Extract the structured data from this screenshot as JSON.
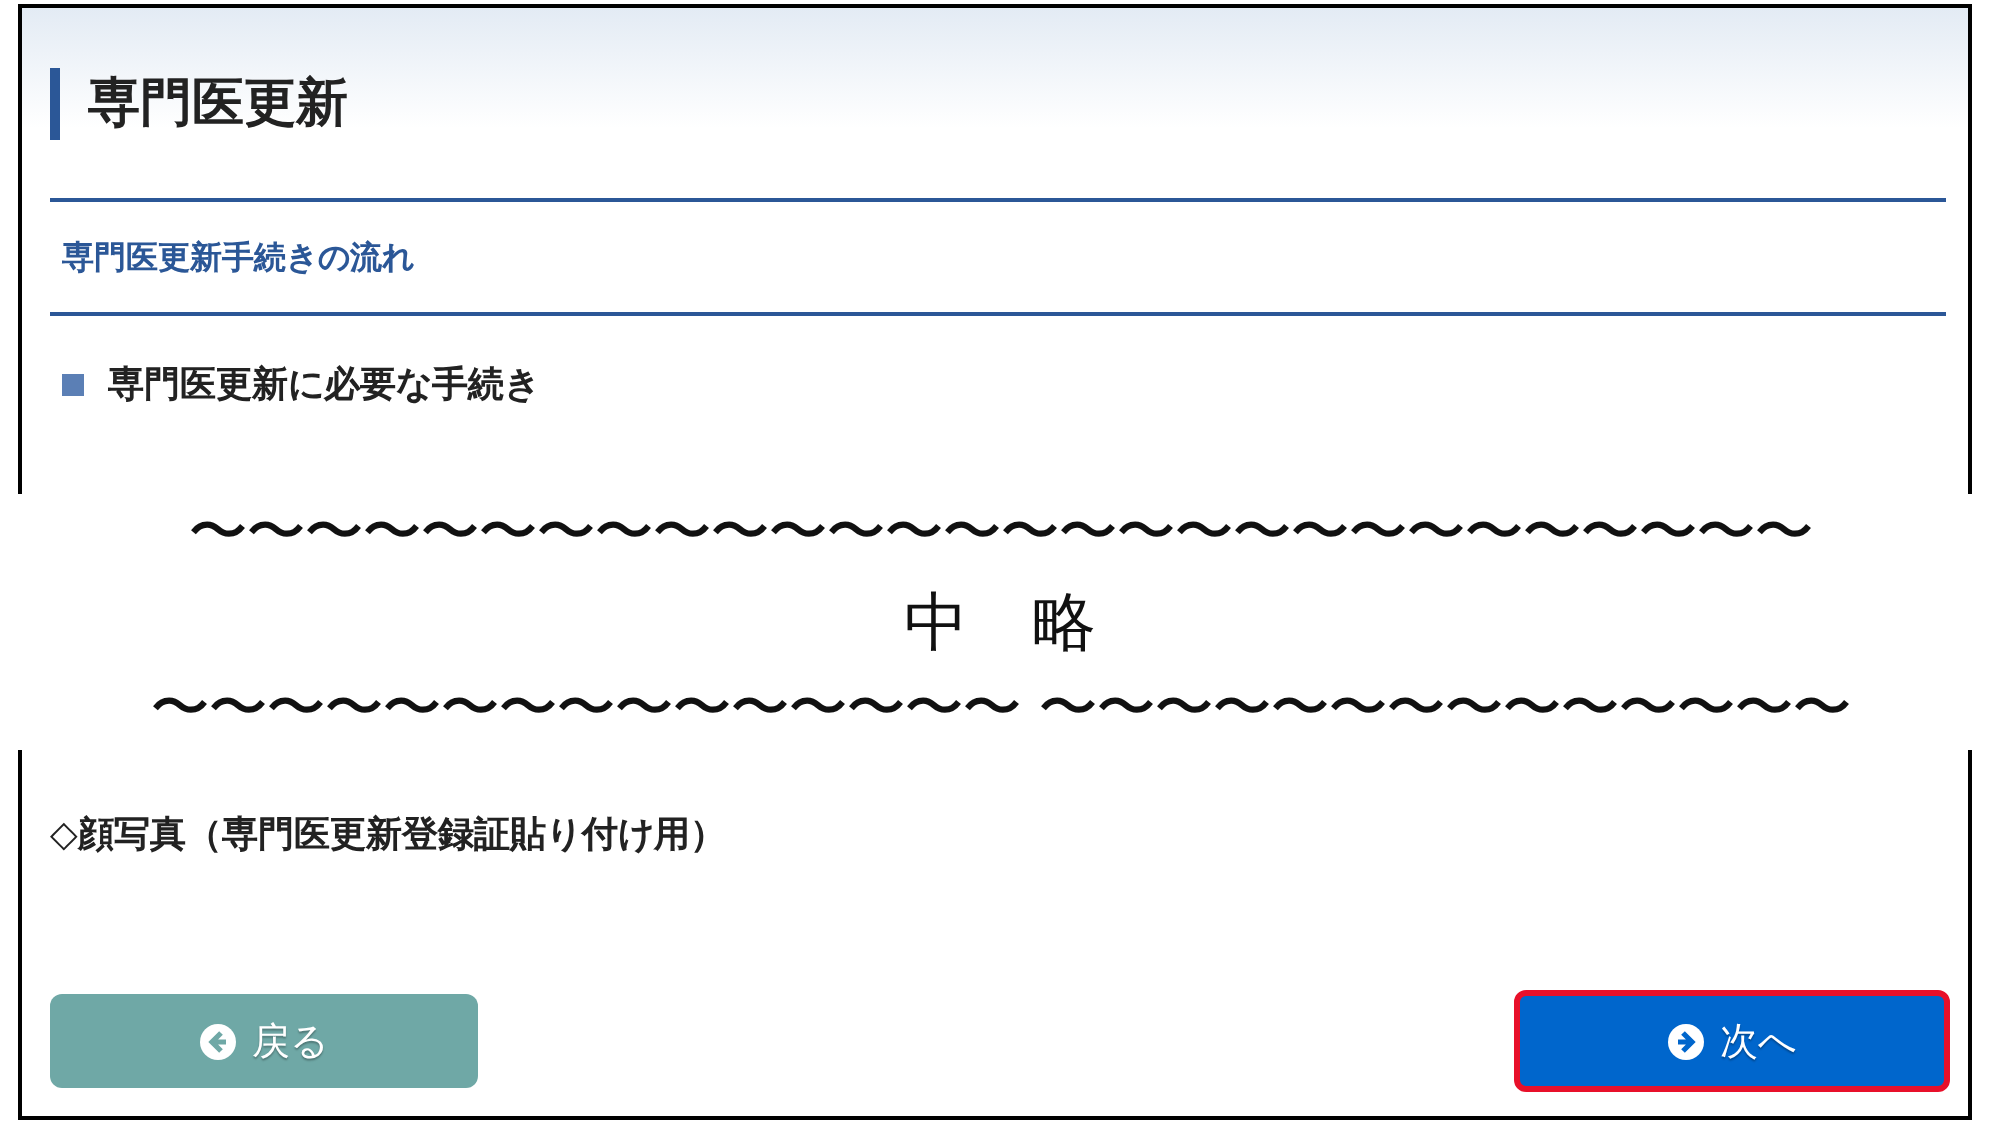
{
  "page_title": "専門医更新",
  "flow_link": "専門医更新手続きの流れ",
  "section_heading": "専門医更新に必要な手続き",
  "omission": {
    "wave_top": "〜〜〜〜〜〜〜〜〜〜〜〜〜〜〜〜〜〜〜〜〜〜〜〜〜〜〜〜",
    "label": "中　略",
    "wave_bottom": "〜〜〜〜〜〜〜〜〜〜〜〜〜〜〜 〜〜〜〜〜〜〜〜〜〜〜〜〜〜"
  },
  "item_heading": "◇顔写真（専門医更新登録証貼り付け用）",
  "buttons": [
    {
      "kind": "back",
      "label": "戻る",
      "highlighted": false
    },
    {
      "kind": "next",
      "label": "次へ",
      "highlighted": true
    }
  ]
}
